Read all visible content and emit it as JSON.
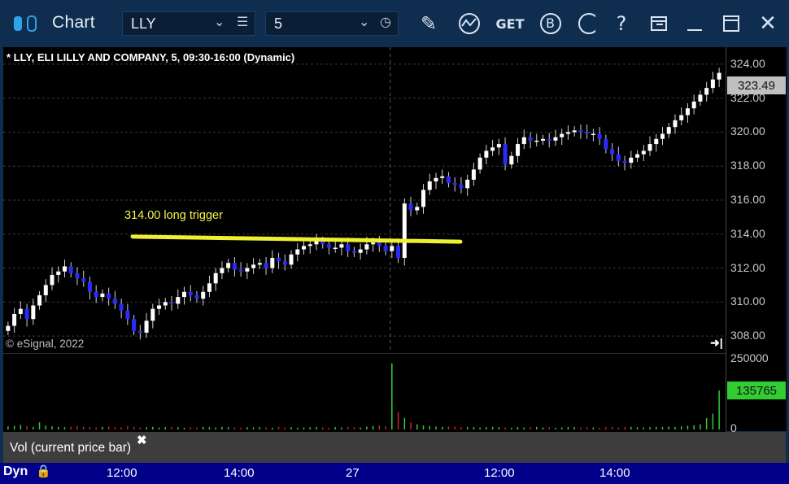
{
  "window": {
    "title": "Chart",
    "symbol": "LLY",
    "interval": "5",
    "toolbar_icons": [
      "pencil-icon",
      "cycle-icon",
      "get-icon",
      "b-icon",
      "t-icon",
      "help-icon",
      "template-icon",
      "minimize-icon",
      "maximize-icon",
      "close-icon"
    ],
    "get_label": "GET",
    "b_label": "B",
    "help_label": "?"
  },
  "chart": {
    "title": "* LLY, ELI LILLY AND COMPANY, 5, 09:30-16:00 (Dynamic)",
    "copyright": "© eSignal, 2022",
    "last_price": "323.49",
    "last_volume": "135765",
    "study_label": "Vol (current price bar)",
    "dyn_label": "Dyn",
    "colors": {
      "up": "#ffffff",
      "down": "#2a2aff",
      "trend_line": "#f0f030",
      "price_badge": "#c0c0c0",
      "volume_badge": "#33cc33",
      "vol_up": "#33cc33",
      "vol_down": "#cc2222"
    }
  },
  "chart_data": {
    "type": "candlestick",
    "price_axis": {
      "ticks": [
        "324.00",
        "322.00",
        "320.00",
        "318.00",
        "316.00",
        "314.00",
        "312.00",
        "310.00",
        "308.00"
      ],
      "ylim": [
        307,
        325
      ]
    },
    "volume_axis": {
      "ticks": [
        "250000",
        "0"
      ],
      "ylim": [
        0,
        260000
      ]
    },
    "x_ticks": [
      "12:00",
      "14:00",
      "27",
      "12:00",
      "14:00"
    ],
    "annotations": [
      {
        "text": "314.00 long trigger",
        "type": "trend_line",
        "from": 313.95,
        "to": 313.65
      }
    ],
    "close_series": [
      308.6,
      309.3,
      309.6,
      309.0,
      309.8,
      310.4,
      311.0,
      311.6,
      311.8,
      312.1,
      311.7,
      311.4,
      311.2,
      310.6,
      310.3,
      310.5,
      310.2,
      309.9,
      309.5,
      309.0,
      308.3,
      308.2,
      308.9,
      309.6,
      309.8,
      310.0,
      309.9,
      310.3,
      310.6,
      310.4,
      310.2,
      310.6,
      311.1,
      311.7,
      312.0,
      312.3,
      311.9,
      311.8,
      312.0,
      312.2,
      312.3,
      312.0,
      312.6,
      312.4,
      312.2,
      312.8,
      313.1,
      313.3,
      313.4,
      313.6,
      313.4,
      313.2,
      313.2,
      313.4,
      313.0,
      312.9,
      313.1,
      313.4,
      313.5,
      313.3,
      313.0,
      313.3,
      312.6,
      315.8,
      315.4,
      315.6,
      316.6,
      317.1,
      317.3,
      317.4,
      317.0,
      316.9,
      316.7,
      317.2,
      317.8,
      318.5,
      318.9,
      319.1,
      319.3,
      318.1,
      318.6,
      319.3,
      319.7,
      319.5,
      319.5,
      319.6,
      319.5,
      319.7,
      319.9,
      320.0,
      320.1,
      320.0,
      319.9,
      319.9,
      319.6,
      319.0,
      318.7,
      318.3,
      318.2,
      318.5,
      318.7,
      318.9,
      319.3,
      319.6,
      319.9,
      320.3,
      320.7,
      321.0,
      321.4,
      321.8,
      322.2,
      322.6,
      323.1,
      323.49
    ],
    "volume_series": [
      11000,
      13000,
      16000,
      12000,
      9000,
      25000,
      14000,
      11000,
      9000,
      8000,
      10000,
      12000,
      9000,
      8000,
      7000,
      9000,
      10000,
      8000,
      7000,
      12000,
      9000,
      7000,
      8000,
      9000,
      7000,
      8000,
      9000,
      8000,
      6000,
      8000,
      7000,
      9000,
      8000,
      7000,
      9000,
      8000,
      7000,
      6000,
      8000,
      7000,
      8000,
      7000,
      6000,
      9000,
      7000,
      8000,
      6000,
      7000,
      8000,
      9000,
      7000,
      6000,
      8000,
      7000,
      9000,
      8000,
      7000,
      10000,
      12000,
      14000,
      11000,
      230000,
      60000,
      40000,
      25000,
      18000,
      14000,
      12000,
      10000,
      9000,
      11000,
      10000,
      8000,
      9000,
      8000,
      7000,
      8000,
      9000,
      8000,
      7000,
      6000,
      8000,
      7000,
      8000,
      9000,
      7000,
      8000,
      6000,
      7000,
      9000,
      8000,
      7000,
      8000,
      7000,
      6000,
      8000,
      9000,
      7000,
      8000,
      9000,
      8000,
      7000,
      8000,
      9000,
      8000,
      10000,
      9000,
      11000,
      13000,
      15000,
      18000,
      40000,
      55000,
      135765
    ]
  }
}
